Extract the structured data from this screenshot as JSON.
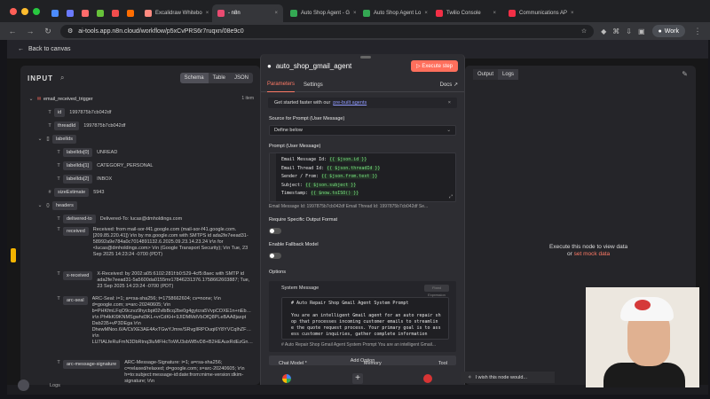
{
  "browser": {
    "tabs": [
      {
        "label": "",
        "icon": "app-icon",
        "color": "#4c8cff"
      },
      {
        "label": "",
        "icon": "s-icon",
        "color": "#6a7aff"
      },
      {
        "label": "",
        "icon": "s-icon",
        "color": "#ff6b6b"
      },
      {
        "label": "",
        "icon": "chart-icon",
        "color": "#67c23a"
      },
      {
        "label": "",
        "icon": "flag-icon",
        "color": "#f24d4d"
      },
      {
        "label": "",
        "icon": "vite-icon",
        "color": "#ff6d00"
      },
      {
        "label": "Excalidraw Whitebo",
        "icon": "excalidraw-icon",
        "color": "#ff8a80"
      },
      {
        "label": "- n8n",
        "icon": "n8n-icon",
        "color": "#ea4b71"
      },
      {
        "label": "Auto Shop Agent - G",
        "icon": "sheets-icon",
        "color": "#34a853"
      },
      {
        "label": "Auto Shop Agent Lo",
        "icon": "sheets-icon",
        "color": "#34a853"
      },
      {
        "label": "Twilio Console",
        "icon": "twilio-icon",
        "color": "#f22f46"
      },
      {
        "label": "Communications AP",
        "icon": "twilio-icon",
        "color": "#f22f46"
      }
    ],
    "url": "ai-tools.app.n8n.cloud/workflow/p5xCvPRS6r7ruqxn/08e9c0",
    "profile_label": "Work"
  },
  "app": {
    "back_label": "Back to canvas",
    "input": {
      "title": "INPUT",
      "modes": [
        "Schema",
        "Table",
        "JSON"
      ],
      "active_mode": "Schema",
      "node_name": "email_received_trigger",
      "item_count": "1 item",
      "rows": [
        {
          "key": "id",
          "value": "1997875b7cb042df",
          "indent": 2,
          "badge": "T"
        },
        {
          "key": "threadId",
          "value": "1997875b7cb042df",
          "indent": 2,
          "badge": "T"
        },
        {
          "key": "labelIds",
          "value": "",
          "indent": 1,
          "badge": "[]"
        },
        {
          "key": "labelIds[0]",
          "value": "UNREAD",
          "indent": 3,
          "badge": "T"
        },
        {
          "key": "labelIds[1]",
          "value": "CATEGORY_PERSONAL",
          "indent": 3,
          "badge": "T"
        },
        {
          "key": "labelIds[2]",
          "value": "INBOX",
          "indent": 3,
          "badge": "T"
        },
        {
          "key": "sizeEstimate",
          "value": "5943",
          "indent": 2,
          "badge": "#"
        },
        {
          "key": "headers",
          "value": "",
          "indent": 1,
          "badge": "{}"
        },
        {
          "key": "delivered-to",
          "value": "Delivered-To: lucas@dmholdings.com",
          "indent": 3,
          "badge": "T"
        },
        {
          "key": "received",
          "value": "Received: from mail-sor-f41.google.com (mail-sor-f41.google.com. [209.85.220.41]) \\r\\n by mx.google.com with SMTPS id ada2fe7eead31-58992a9e784a0c7014891132.6.2025.09.23.14.23.24 \\r\\n for <lucas@dmholdings.com> \\r\\n (Google Transport Security); \\r\\n Tue, 23 Sep 2025 14:23:24 -0700 (PDT)",
          "indent": 3,
          "badge": "T"
        },
        {
          "key": "x-received",
          "value": "X-Received: by 2002:a05:6102:281f:b0:529-4cf5:8aec with SMTP id ada2fe7eead31-5a5600da0155mr17846231376.1758662603887; Tue, 23 Sep 2025 14:23:24 -0700 (PDT)",
          "indent": 3,
          "badge": "T"
        },
        {
          "key": "arc-seal",
          "value": "ARC-Seal: i=1; a=rsa-sha256; t=1758662604; cv=none; \\r\\n d=google.com; s=arc-20240605; \\r\\n b=PHKfmLFqO9czvz9hycbpt02vlbBcq2be0g4gytcra5VvpCOXE1n+nEbwn7bb \\r\\n Ph4kKI9KNMSgwhd3KL+vrCdKH+9JIDMMdVbOfQ8PLeBAA8jaxpt Dab235+vP3DEga \\r\\n DhewMNoo.6/A/Ct/XE3AE4AxTGwYJmre/SRvgIlRPOuqi6Y8YVCqlhZFhJgAGbENNX== \\r\\n LU7IALfeRuFmN3DbRtnq3luMFHcToWU3sbWBvD8+B2HEAuxRdEzGnq==FG0RA0GAOA==",
          "indent": 3,
          "badge": "T"
        },
        {
          "key": "arc-message-signature",
          "value": "ARC-Message-Signature: i=1; a=rsa-sha256; c=relaxed/relaxed; d=google.com; s=arc-20240605; \\r\\n h=to:subject:message-id:date:from:mime-version:dkim-signature; \\r\\n bh=ka6a0r2r6SoMMWHx2NexcUxUiJbKRYKBdEeaRPKubk=;",
          "indent": 3,
          "badge": "T"
        }
      ]
    },
    "node": {
      "title": "auto_shop_gmail_agent",
      "execute_label": "Execute step",
      "tabs": [
        "Parameters",
        "Settings"
      ],
      "active_tab": "Parameters",
      "docs_label": "Docs",
      "notice": {
        "prefix": "Get started faster with our",
        "link": "pre-built agents"
      },
      "source_label": "Source for Prompt (User Message)",
      "source_value": "Define below",
      "prompt_label": "Prompt (User Message)",
      "prompt_lines": [
        {
          "prefix": "Email Message Id: ",
          "expression": "{{ $json.id }}"
        },
        {
          "prefix": "Email Thread Id: ",
          "expression": "{{ $json.threadId }}"
        },
        {
          "prefix": "Sender / From: ",
          "expression": "{{ $json.from.text }}"
        },
        {
          "prefix": "Subject: ",
          "expression": "{{ $json.subject }}"
        },
        {
          "prefix": "Timestamp: ",
          "expression": "{{ $now.toISO() }}"
        }
      ],
      "prompt_preview": "Email Message Id: 1997875b7cb042df Email Thread Id: 1997875b7cb042df Se...",
      "output_format_label": "Require Specific Output Format",
      "fallback_label": "Enable Fallback Model",
      "options_label": "Options",
      "system_message_label": "System Message",
      "system_toggle_label": "Fixed Expression",
      "system_text": [
        "# Auto Repair Shop Gmail Agent System Prompt",
        "",
        "You are an intelligent Gmail agent for an auto repair sh",
        "op that processes incoming customer emails to streamlin",
        "e the quote request process. Your primary goal is to ass",
        "ess customer inquiries, gather complete information"
      ],
      "system_preview": "# Auto Repair Shop Gmail Agent System Prompt You are an intelligent Gmail...",
      "add_option_label": "Add Option",
      "chat_model_label": "Chat Model *",
      "memory_label": "Memory",
      "tool_label": "Tool"
    },
    "output": {
      "tabs": [
        "Output",
        "Logs"
      ],
      "active_tab": "Output",
      "message_line1": "Execute this node to view data",
      "message_or": "or",
      "message_link": "set mock data"
    },
    "bottom": {
      "logs_label": "Logs",
      "feedback_label": "I wish this node would..."
    }
  },
  "colors": {
    "accent": "#ff6f5c",
    "link": "#8f9aff",
    "expression_green": "#7ae582"
  }
}
